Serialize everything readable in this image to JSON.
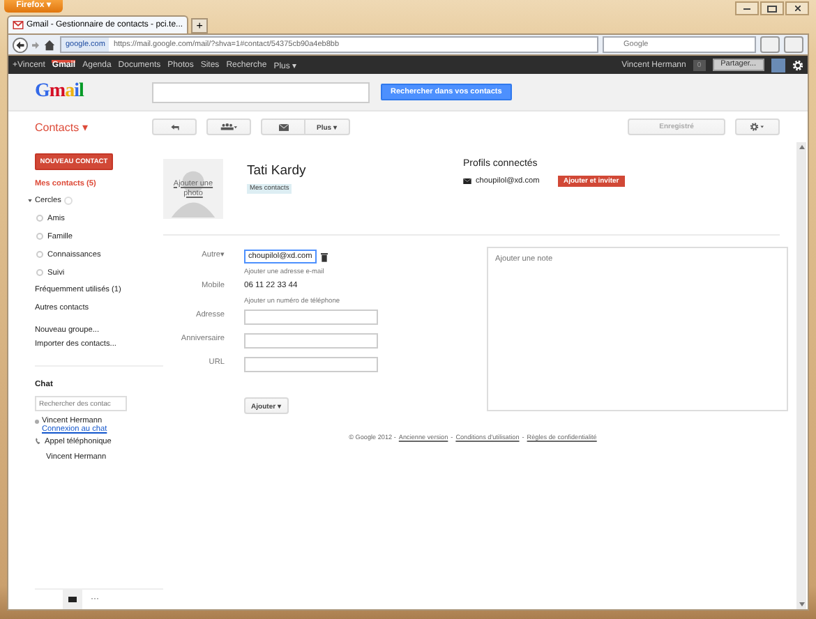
{
  "browser": {
    "menu_button": "Firefox ▾",
    "tab_title": "Gmail - Gestionnaire de contacts - pci.te...",
    "new_tab": "+",
    "identity": "google.com",
    "url": "https://mail.google.com/mail/?shva=1#contact/54375cb90a4eb8bb",
    "search_placeholder": "Google"
  },
  "google_bar": {
    "items": [
      {
        "label": "+Vincent",
        "selected": false
      },
      {
        "label": "Gmail",
        "selected": true
      },
      {
        "label": "Agenda",
        "selected": false
      },
      {
        "label": "Documents",
        "selected": false
      },
      {
        "label": "Photos",
        "selected": false
      },
      {
        "label": "Sites",
        "selected": false
      },
      {
        "label": "Recherche",
        "selected": false
      },
      {
        "label": "Plus ▾",
        "selected": false
      }
    ],
    "user": "Vincent Hermann",
    "count": "0",
    "share": "Partager..."
  },
  "header": {
    "logo": "Gmail",
    "search_button": "Rechercher dans vos contacts"
  },
  "toolbar": {
    "title": "Contacts ▾",
    "more": "Plus ▾",
    "save": "Enregistré"
  },
  "sidebar": {
    "new_contact": "NOUVEAU CONTACT",
    "items": [
      {
        "label": "Mes contacts (5)",
        "selected": true
      }
    ],
    "circles_label": "Cercles",
    "circles": [
      "Amis",
      "Famille",
      "Connaissances",
      "Suivi"
    ],
    "links": [
      {
        "label": "Fréquemment utilisés (1)",
        "selected": false
      },
      {
        "label": "Autres contacts",
        "selected": false
      }
    ],
    "actions": [
      "Nouveau groupe...",
      "Importer des contacts..."
    ],
    "chat": {
      "title": "Chat",
      "search_placeholder": "Rechercher des contac",
      "user": "Vincent Hermann",
      "connect": "Connexion au chat",
      "phone": "Appel téléphonique",
      "phone_user": "Vincent Hermann",
      "more": "···"
    }
  },
  "contact": {
    "photo_link": "Ajouter une photo",
    "name": "Tati Kardy",
    "tag": "Mes contacts",
    "profiles": {
      "title": "Profils connectés",
      "email": "choupilol@xd.com",
      "button": "Ajouter et inviter"
    },
    "fields": [
      {
        "kind": "email",
        "label": "Autre▾",
        "value": "choupilol@xd.com",
        "hint": "Ajouter une adresse e-mail"
      },
      {
        "kind": "text",
        "label": "Mobile",
        "value": "06 11 22 33 44",
        "hint": "Ajouter un numéro de téléphone"
      },
      {
        "kind": "input",
        "label": "Adresse"
      },
      {
        "kind": "input",
        "label": "Anniversaire"
      },
      {
        "kind": "input",
        "label": "URL"
      }
    ],
    "note_placeholder": "Ajouter une note",
    "add_button": "Ajouter ▾"
  },
  "footer": {
    "copyright": "© Google 2012 -",
    "separator": "-",
    "links": [
      "Ancienne version",
      "Conditions d'utilisation",
      "Règles de confidentialité"
    ]
  }
}
